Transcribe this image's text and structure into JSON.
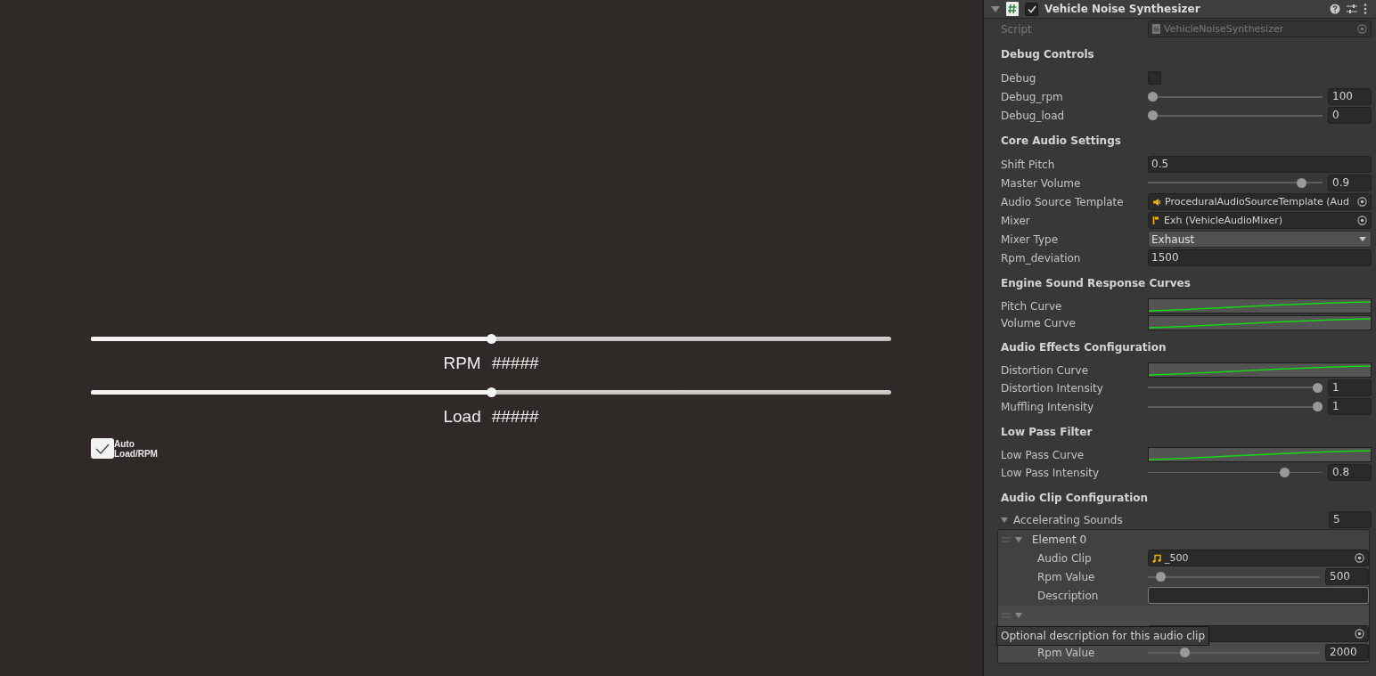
{
  "game": {
    "sliders": [
      {
        "label": "RPM",
        "value": "#####",
        "level": 0.5
      },
      {
        "label": "Load",
        "value": "#####",
        "level": 0.5
      }
    ],
    "toggle": {
      "label": "Auto Load/RPM",
      "checked": true
    }
  },
  "inspector": {
    "header": {
      "title": "Vehicle Noise Synthesizer",
      "enabled": true,
      "expanded": true
    },
    "rows": [
      {
        "kind": "script_ref",
        "label": "Script",
        "value": "VehicleNoiseSynthesizer",
        "disabled": true
      },
      {
        "kind": "section",
        "label": "Debug Controls"
      },
      {
        "kind": "toggle",
        "label": "Debug",
        "checked": false
      },
      {
        "kind": "slider",
        "label": "Debug_rpm",
        "level": 0,
        "value": "100"
      },
      {
        "kind": "slider",
        "label": "Debug_load",
        "level": 0,
        "value": "0"
      },
      {
        "kind": "section",
        "label": "Core Audio Settings"
      },
      {
        "kind": "text",
        "label": "Shift Pitch",
        "value": "0.5"
      },
      {
        "kind": "slider",
        "label": "Master Volume",
        "level": 0.9,
        "value": "0.9"
      },
      {
        "kind": "audio_source_ref",
        "label": "Audio Source Template",
        "value": "ProceduralAudioSourceTemplate (Aud"
      },
      {
        "kind": "mixer_ref",
        "label": "Mixer",
        "value": "Exh (VehicleAudioMixer)"
      },
      {
        "kind": "dropdown",
        "label": "Mixer Type",
        "value": "Exhaust"
      },
      {
        "kind": "text",
        "label": "Rpm_deviation",
        "value": "1500"
      },
      {
        "kind": "section",
        "label": "Engine Sound Response Curves"
      },
      {
        "kind": "curve",
        "label": "Pitch Curve"
      },
      {
        "kind": "curve",
        "label": "Volume Curve"
      },
      {
        "kind": "section",
        "label": "Audio Effects Configuration"
      },
      {
        "kind": "curve",
        "label": "Distortion Curve"
      },
      {
        "kind": "slider",
        "label": "Distortion Intensity",
        "level": 1,
        "value": "1"
      },
      {
        "kind": "slider",
        "label": "Muffling Intensity",
        "level": 1,
        "value": "1"
      },
      {
        "kind": "section",
        "label": "Low Pass Filter"
      },
      {
        "kind": "curve",
        "label": "Low Pass Curve"
      },
      {
        "kind": "slider",
        "label": "Low Pass Intensity",
        "level": 0.8,
        "value": "0.8"
      },
      {
        "kind": "section",
        "label": "Audio Clip Configuration"
      },
      {
        "kind": "list",
        "label": "Accelerating Sounds",
        "count": "5",
        "expanded": true,
        "elements": [
          {
            "label": "Element 0",
            "expanded": true,
            "rows": [
              {
                "kind": "clip_ref",
                "label": "Audio Clip",
                "value": "_500"
              },
              {
                "kind": "slider",
                "label": "Rpm Value",
                "level": 0.05,
                "value": "500"
              },
              {
                "kind": "text",
                "label": "Description",
                "value": ""
              }
            ]
          },
          {
            "expanded": true,
            "rows": [
              {
                "kind": "clip_ref"
              },
              {
                "kind": "slider",
                "label": "Rpm Value",
                "level": 0.2,
                "value": "2000"
              }
            ]
          }
        ]
      }
    ]
  },
  "tooltip": {
    "text": "Optional description for this audio clip"
  }
}
